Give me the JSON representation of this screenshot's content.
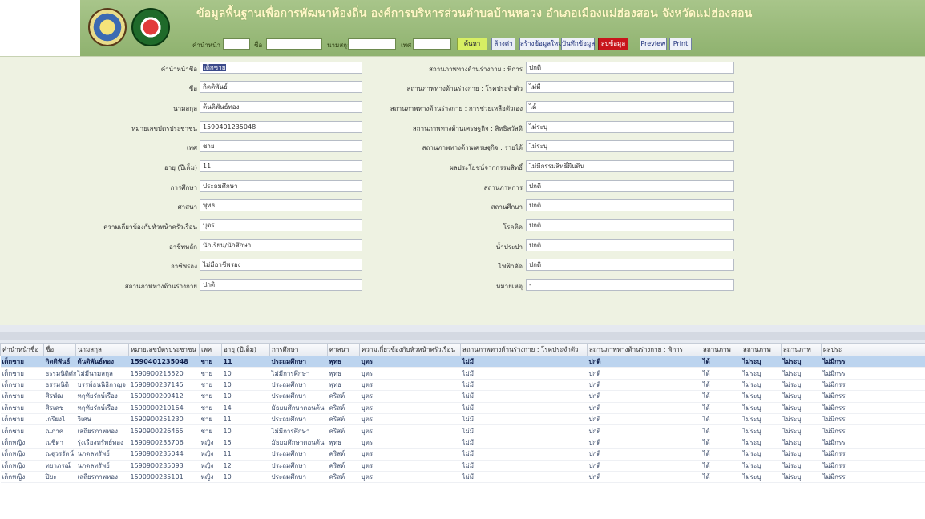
{
  "header": {
    "title": "ข้อมูลพื้นฐานเพื่อการพัฒนาท้องถิ่น องค์การบริหารส่วนตำบลบ้านหลวง อำเภอเมืองแม่ฮ่องสอน จังหวัดแม่ฮ่องสอน"
  },
  "search": {
    "prefix_label": "คำนำหน้า",
    "first_name_label": "ชื่อ",
    "last_name_label": "นามสกุล",
    "gender_label": "เพศ",
    "search_button": "ค้นหา",
    "clear_button": "ล้างค่า",
    "new_button": "สร้างข้อมูลใหม่",
    "record_button": "บันทึกข้อมูล",
    "save_button": "ลบข้อมูล",
    "preview_button": "Preview",
    "print_button": "Print"
  },
  "form": {
    "left": [
      {
        "label": "คำนำหน้าชื่อ",
        "value": "เด็กชาย"
      },
      {
        "label": "ชื่อ",
        "value": "กิตติพันธ์"
      },
      {
        "label": "นามสกุล",
        "value": "ต้นติพันธ์ทอง"
      },
      {
        "label": "หมายเลขบัตรประชาชน",
        "value": "1590401235048"
      },
      {
        "label": "เพศ",
        "value": "ชาย"
      },
      {
        "label": "อายุ (ปีเต็ม)",
        "value": "11"
      },
      {
        "label": "การศึกษา",
        "value": "ประถมศึกษา"
      },
      {
        "label": "ศาสนา",
        "value": "พุทธ"
      },
      {
        "label": "ความเกี่ยวข้องกับหัวหน้าครัวเรือน",
        "value": "บุตร"
      },
      {
        "label": "อาชีพหลัก",
        "value": "นักเรียน/นักศึกษา"
      },
      {
        "label": "อาชีพรอง",
        "value": "ไม่มีอาชีพรอง"
      },
      {
        "label": "สถานภาพทางด้านร่างกาย",
        "value": "ปกติ"
      }
    ],
    "right": [
      {
        "label": "สถานภาพทางด้านร่างกาย : พิการ",
        "value": "ปกติ"
      },
      {
        "label": "สถานภาพทางด้านร่างกาย : โรคประจำตัว",
        "value": "ไม่มี"
      },
      {
        "label": "สถานภาพทางด้านร่างกาย : การช่วยเหลือตัวเอง",
        "value": "ได้"
      },
      {
        "label": "สถานภาพทางด้านเศรษฐกิจ : สิทธิสวัสดิ",
        "value": "ไม่ระบุ"
      },
      {
        "label": "สถานภาพทางด้านเศรษฐกิจ : รายได้",
        "value": "ไม่ระบุ"
      },
      {
        "label": "ผลประโยชน์จากกรรมสิทธิ์",
        "value": "ไม่มีกรรมสิทธิ์ผืนดิน"
      },
      {
        "label": "สถานภาพการ",
        "value": "ปกติ"
      },
      {
        "label": "สถานศึกษา",
        "value": "ปกติ"
      },
      {
        "label": "โรคติด",
        "value": "ปกติ"
      },
      {
        "label": "น้ำประปา",
        "value": "ปกติ"
      },
      {
        "label": "ไฟฟ้าคัด",
        "value": "ปกติ"
      },
      {
        "label": "หมายเหตุ",
        "value": "-"
      }
    ]
  },
  "grid": {
    "columns": [
      "คำนำหน้าชื่อ",
      "ชื่อ",
      "นามสกุล",
      "หมายเลขบัตรประชาชน",
      "เพศ",
      "อายุ (ปีเต็ม)",
      "การศึกษา",
      "ศาสนา",
      "ความเกี่ยวข้องกับหัวหน้าครัวเรือน",
      "สถานภาพทางด้านร่างกาย : โรคประจำตัว",
      "สถานภาพทางด้านร่างกาย : พิการ",
      "สถานภาพ",
      "สถานภาพ",
      "สถานภาพ",
      "ผลประ"
    ],
    "rows": [
      [
        "เด็กชาย",
        "กิตติพันธ์",
        "ต้นติพันธ์ทอง",
        "1590401235048",
        "ชาย",
        "11",
        "ประถมศึกษา",
        "พุทธ",
        "บุตร",
        "ไม่มี",
        "ปกติ",
        "ได้",
        "ไม่ระบุ",
        "ไม่ระบุ",
        "ไม่มีกรร"
      ],
      [
        "เด็กชาย",
        "ธรรมนิติศักดิ์",
        "ไม่มีนามสกุล",
        "1590900215520",
        "ชาย",
        "10",
        "ไม่มีการศึกษา",
        "พุทธ",
        "บุตร",
        "ไม่มี",
        "ปกติ",
        "ได้",
        "ไม่ระบุ",
        "ไม่ระบุ",
        "ไม่มีกรร"
      ],
      [
        "เด็กชาย",
        "ธรรมนิติ",
        "บรรพ์ธนนิธิกาญจ",
        "1590900237145",
        "ชาย",
        "10",
        "ประถมศึกษา",
        "พุทธ",
        "บุตร",
        "ไม่มี",
        "ปกติ",
        "ได้",
        "ไม่ระบุ",
        "ไม่ระบุ",
        "ไม่มีกรร"
      ],
      [
        "เด็กชาย",
        "ศิรพัฒ",
        "หฤทัยรักษ์เรือง",
        "1590900209412",
        "ชาย",
        "10",
        "ประถมศึกษา",
        "คริสต์",
        "บุตร",
        "ไม่มี",
        "ปกติ",
        "ได้",
        "ไม่ระบุ",
        "ไม่ระบุ",
        "ไม่มีกรร"
      ],
      [
        "เด็กชาย",
        "ศิรเดช",
        "หฤทัยรักษ์เรือง",
        "1590900210164",
        "ชาย",
        "14",
        "มัธยมศึกษาตอนต้น",
        "คริสต์",
        "บุตร",
        "ไม่มี",
        "ปกติ",
        "ได้",
        "ไม่ระบุ",
        "ไม่ระบุ",
        "ไม่มีกรร"
      ],
      [
        "เด็กชาย",
        "เกรียงไ",
        "วิเศษ",
        "1590900251230",
        "ชาย",
        "11",
        "ประถมศึกษา",
        "คริสต์",
        "บุตร",
        "ไม่มี",
        "ปกติ",
        "ได้",
        "ไม่ระบุ",
        "ไม่ระบุ",
        "ไม่มีกรร"
      ],
      [
        "เด็กชาย",
        "ณภาค",
        "เสถียรภาพทอง",
        "1590900226465",
        "ชาย",
        "10",
        "ไม่มีการศึกษา",
        "คริสต์",
        "บุตร",
        "ไม่มี",
        "ปกติ",
        "ได้",
        "ไม่ระบุ",
        "ไม่ระบุ",
        "ไม่มีกรร"
      ],
      [
        "เด็กหญิง",
        "ณชิดา",
        "รุ่งเรืองทรัพย์ทอง",
        "1590900235706",
        "หญิง",
        "15",
        "มัธยมศึกษาตอนต้น",
        "พุทธ",
        "บุตร",
        "ไม่มี",
        "ปกติ",
        "ได้",
        "ไม่ระบุ",
        "ไม่ระบุ",
        "ไม่มีกรร"
      ],
      [
        "เด็กหญิง",
        "ณฐุวรรัตน์",
        "นภดลทรัพย์",
        "1590900235044",
        "หญิง",
        "11",
        "ประถมศึกษา",
        "คริสต์",
        "บุตร",
        "ไม่มี",
        "ปกติ",
        "ได้",
        "ไม่ระบุ",
        "ไม่ระบุ",
        "ไม่มีกรร"
      ],
      [
        "เด็กหญิง",
        "ทยาภรณ์",
        "นภดลทรัพย์",
        "1590900235093",
        "หญิง",
        "12",
        "ประถมศึกษา",
        "คริสต์",
        "บุตร",
        "ไม่มี",
        "ปกติ",
        "ได้",
        "ไม่ระบุ",
        "ไม่ระบุ",
        "ไม่มีกรร"
      ],
      [
        "เด็กหญิง",
        "ปิยะ",
        "เสถียรภาพทอง",
        "1590900235101",
        "หญิง",
        "10",
        "ประถมศึกษา",
        "คริสต์",
        "บุตร",
        "ไม่มี",
        "ปกติ",
        "ได้",
        "ไม่ระบุ",
        "ไม่ระบุ",
        "ไม่มีกรร"
      ]
    ]
  }
}
